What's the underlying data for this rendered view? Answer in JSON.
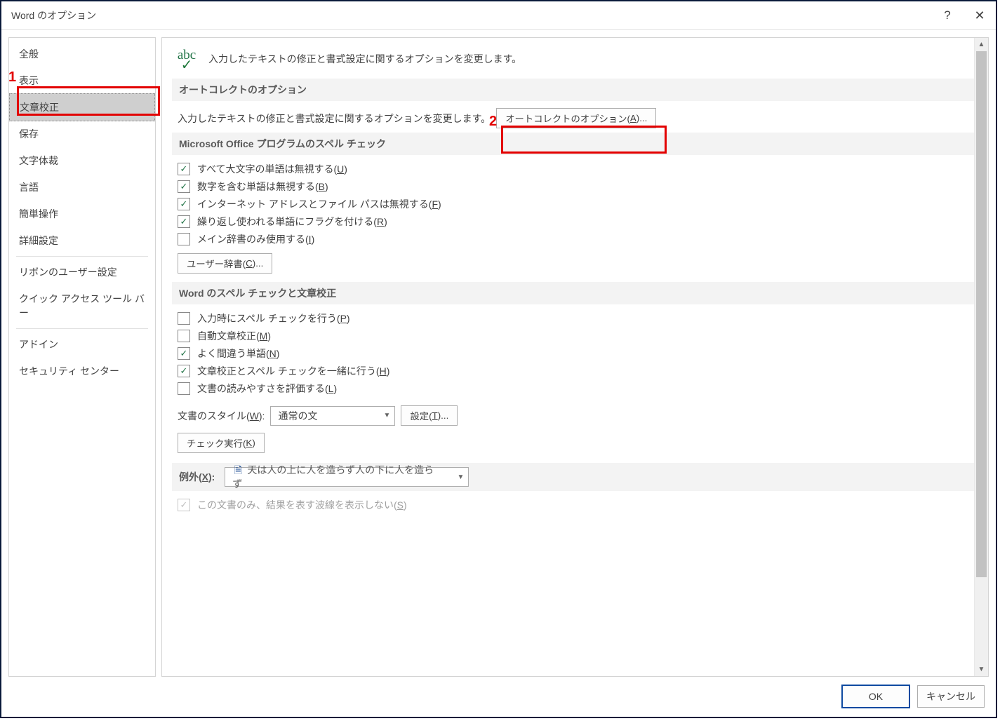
{
  "window": {
    "title": "Word のオプション"
  },
  "sidebar": {
    "items": [
      {
        "label": "全般"
      },
      {
        "label": "表示"
      },
      {
        "label": "文章校正",
        "selected": true
      },
      {
        "label": "保存"
      },
      {
        "label": "文字体裁"
      },
      {
        "label": "言語"
      },
      {
        "label": "簡単操作"
      },
      {
        "label": "詳細設定"
      }
    ],
    "items2": [
      {
        "label": "リボンのユーザー設定"
      },
      {
        "label": "クイック アクセス ツール バー"
      }
    ],
    "items3": [
      {
        "label": "アドイン"
      },
      {
        "label": "セキュリティ センター"
      }
    ]
  },
  "annotations": {
    "num1": "1",
    "num2": "2"
  },
  "header": {
    "abc": "abc",
    "desc": "入力したテキストの修正と書式設定に関するオプションを変更します。"
  },
  "sec_autocorrect": {
    "title": "オートコレクトのオプション",
    "desc": "入力したテキストの修正と書式設定に関するオプションを変更します。",
    "btn_pre": "オートコレクトのオプション(",
    "btn_u": "A",
    "btn_post": ")..."
  },
  "sec_spell": {
    "title": "Microsoft Office プログラムのスペル チェック",
    "cb1_pre": "すべて大文字の単語は無視する(",
    "cb1_u": "U",
    "cb1_post": ")",
    "cb2_pre": "数字を含む単語は無視する(",
    "cb2_u": "B",
    "cb2_post": ")",
    "cb3_pre": "インターネット アドレスとファイル パスは無視する(",
    "cb3_u": "F",
    "cb3_post": ")",
    "cb4_pre": "繰り返し使われる単語にフラグを付ける(",
    "cb4_u": "R",
    "cb4_post": ")",
    "cb5_pre": "メイン辞書のみ使用する(",
    "cb5_u": "I",
    "cb5_post": ")",
    "dict_btn_pre": "ユーザー辞書(",
    "dict_btn_u": "C",
    "dict_btn_post": ")..."
  },
  "sec_wordspell": {
    "title": "Word のスペル チェックと文章校正",
    "cb1_pre": "入力時にスペル チェックを行う(",
    "cb1_u": "P",
    "cb1_post": ")",
    "cb2_pre": "自動文章校正(",
    "cb2_u": "M",
    "cb2_post": ")",
    "cb3_pre": "よく間違う単語(",
    "cb3_u": "N",
    "cb3_post": ")",
    "cb4_pre": "文章校正とスペル チェックを一緒に行う(",
    "cb4_u": "H",
    "cb4_post": ")",
    "cb5_pre": "文書の読みやすさを評価する(",
    "cb5_u": "L",
    "cb5_post": ")",
    "style_label_pre": "文書のスタイル(",
    "style_label_u": "W",
    "style_label_post": "):",
    "style_value": "通常の文",
    "settings_btn_pre": "設定(",
    "settings_btn_u": "T",
    "settings_btn_post": ")...",
    "check_btn_pre": "チェック実行(",
    "check_btn_u": "K",
    "check_btn_post": ")"
  },
  "sec_exception": {
    "title_pre": "例外(",
    "title_u": "X",
    "title_post": "):",
    "doc_value": "天は人の上に人を造らず人の下に人を造らず",
    "cb1_pre": "この文書のみ、結果を表す波線を表示しない(",
    "cb1_u": "S",
    "cb1_post": ")"
  },
  "footer": {
    "ok": "OK",
    "cancel": "キャンセル"
  }
}
